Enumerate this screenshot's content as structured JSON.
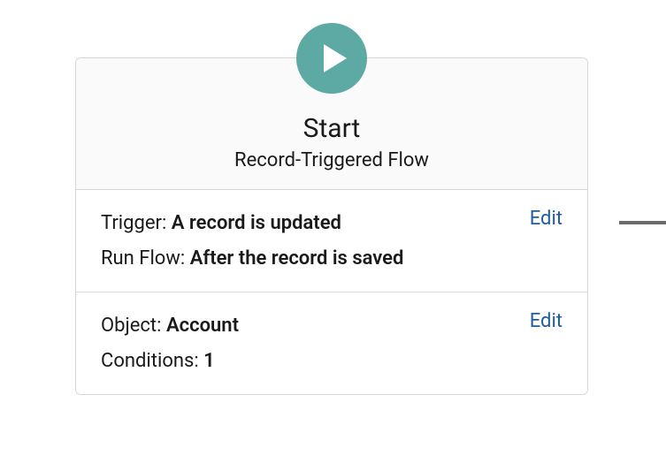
{
  "header": {
    "title": "Start",
    "subtitle": "Record-Triggered Flow"
  },
  "triggerSection": {
    "triggerLabel": "Trigger:",
    "triggerValue": "A record is updated",
    "runFlowLabel": "Run Flow:",
    "runFlowValue": "After the record is saved",
    "editLabel": "Edit"
  },
  "objectSection": {
    "objectLabel": "Object:",
    "objectValue": "Account",
    "conditionsLabel": "Conditions:",
    "conditionsValue": "1",
    "editLabel": "Edit"
  }
}
